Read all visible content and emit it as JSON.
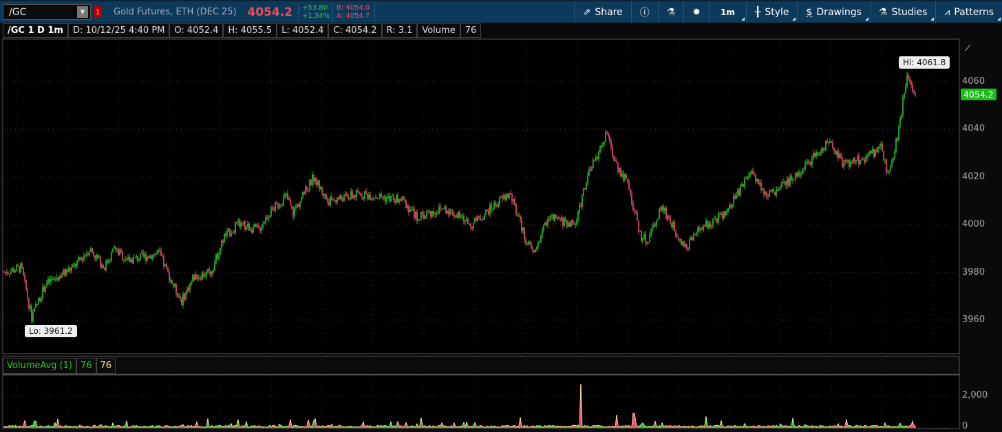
{
  "topbar": {
    "symbol": "/GC",
    "link_badge": "1",
    "description": "Gold Futures, ETH (DEC 25)",
    "last": "4054.2",
    "change": "+53.80",
    "change_pct": "+1.34%",
    "bid": "B: 4054.0",
    "ask": "A: 4054.7",
    "tools": {
      "share": "Share",
      "timeframe": "1m",
      "style": "Style",
      "drawings": "Drawings",
      "studies": "Studies",
      "patterns": "Patterns"
    }
  },
  "info": {
    "title": "/GC 1 D 1m",
    "date": "D: 10/12/25 4:40 PM",
    "open": "O: 4052.4",
    "high": "H: 4055.5",
    "low": "L: 4052.4",
    "close": "C: 4054.2",
    "range": "R: 3.1",
    "volume_label": "Volume",
    "volume_value": "76"
  },
  "volume_study": {
    "label": "VolumeAvg (1)",
    "value1": "76",
    "value2": "76"
  },
  "colors": {
    "up": "#22cc22",
    "down": "#f0506a",
    "volume_avg": "#f0e0a0",
    "accent": "#0d3a5a"
  },
  "chart_data": {
    "type": "candlestick",
    "price_axis": {
      "ticks": [
        "4060",
        "4040",
        "4020",
        "4000",
        "3980",
        "3960"
      ],
      "tick_values": [
        4060,
        4040,
        4020,
        4000,
        3980,
        3960
      ],
      "ylim": [
        3950,
        4073
      ]
    },
    "volume_axis": {
      "ticks": [
        "2,000",
        "0"
      ],
      "tick_values": [
        2000,
        0
      ],
      "ylim": [
        0,
        2700
      ]
    },
    "hi_label": "Hi: 4061.8",
    "lo_label": "Lo: 3961.2",
    "last_badge": "4054.2",
    "hi_value": 4061.8,
    "lo_value": 3961.2,
    "bar_count": 1325,
    "path_anchors_minute_price": [
      [
        0,
        3980
      ],
      [
        25,
        3982
      ],
      [
        40,
        3961.2
      ],
      [
        60,
        3975
      ],
      [
        100,
        3982
      ],
      [
        125,
        3990
      ],
      [
        145,
        3982
      ],
      [
        160,
        3990
      ],
      [
        180,
        3985
      ],
      [
        225,
        3988
      ],
      [
        245,
        3975
      ],
      [
        258,
        3968
      ],
      [
        275,
        3978
      ],
      [
        300,
        3980
      ],
      [
        320,
        3995
      ],
      [
        340,
        4000
      ],
      [
        370,
        3998
      ],
      [
        385,
        4005
      ],
      [
        410,
        4012
      ],
      [
        420,
        4005
      ],
      [
        450,
        4020
      ],
      [
        470,
        4010
      ],
      [
        520,
        4013
      ],
      [
        580,
        4010
      ],
      [
        600,
        4003
      ],
      [
        640,
        4007
      ],
      [
        680,
        4000
      ],
      [
        720,
        4010
      ],
      [
        735,
        4013
      ],
      [
        760,
        3992
      ],
      [
        770,
        3988
      ],
      [
        790,
        4003
      ],
      [
        830,
        4000
      ],
      [
        845,
        4018
      ],
      [
        875,
        4038
      ],
      [
        890,
        4025
      ],
      [
        905,
        4018
      ],
      [
        925,
        3995
      ],
      [
        935,
        3993
      ],
      [
        955,
        4008
      ],
      [
        990,
        3990
      ],
      [
        1010,
        3998
      ],
      [
        1050,
        4005
      ],
      [
        1085,
        4023
      ],
      [
        1110,
        4012
      ],
      [
        1140,
        4018
      ],
      [
        1200,
        4035
      ],
      [
        1220,
        4025
      ],
      [
        1250,
        4028
      ],
      [
        1275,
        4032
      ],
      [
        1285,
        4020
      ],
      [
        1300,
        4040
      ],
      [
        1311,
        4061.8
      ],
      [
        1325,
        4054.2
      ]
    ],
    "volume_spikes_minute_value": [
      [
        30,
        450
      ],
      [
        45,
        420
      ],
      [
        110,
        180
      ],
      [
        260,
        200
      ],
      [
        400,
        230
      ],
      [
        600,
        250
      ],
      [
        750,
        650
      ],
      [
        838,
        2700
      ],
      [
        890,
        800
      ],
      [
        915,
        900
      ],
      [
        1020,
        700
      ],
      [
        1280,
        300
      ]
    ]
  }
}
